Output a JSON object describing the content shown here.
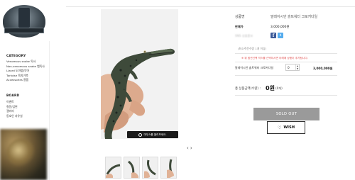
{
  "sidebar": {
    "category_title": "CATEGORY",
    "categories": [
      "Venomous snake 독사",
      "Non-venomous snake 뱀독사",
      "Lizard 도마뱀/악어",
      "Tortoise 육지거북",
      "Accessories 용품"
    ],
    "board_title": "BOARD",
    "boards": [
      "이벤트",
      "질문/답변",
      "갤러리",
      "동호인 자유실"
    ]
  },
  "product": {
    "name_label": "상품명",
    "name_value": "말레이시안 슬트워터 크로커다일",
    "price_label": "판매가",
    "price_value": "3,000,000원",
    "extra_label": "SNS 상품홍보",
    "sns": {
      "facebook_glyph": "f",
      "twitter_glyph": "t"
    },
    "min_qty_note": "(최소주문수량 1개 이상)",
    "option_note": "※ 위 옵션선택 박스를 선택하시면 아래에 상품이 추가됩니다.",
    "selected": {
      "name": "말레이시안 솔트워터 크로커다일",
      "qty": "0",
      "price": "3,000,000원"
    },
    "total_label": "총 상품금액(수량) :",
    "total_value": "0원",
    "total_count": "(0개)",
    "soldout_label": "SOLD OUT",
    "wish_label": "WISH",
    "wish_icon": "heart-outline-icon"
  },
  "gallery": {
    "zoom_caption": "마우스를 올려보세요.",
    "prev_glyph": "‹",
    "next_glyph": "›",
    "thumbnail_count": 4
  }
}
